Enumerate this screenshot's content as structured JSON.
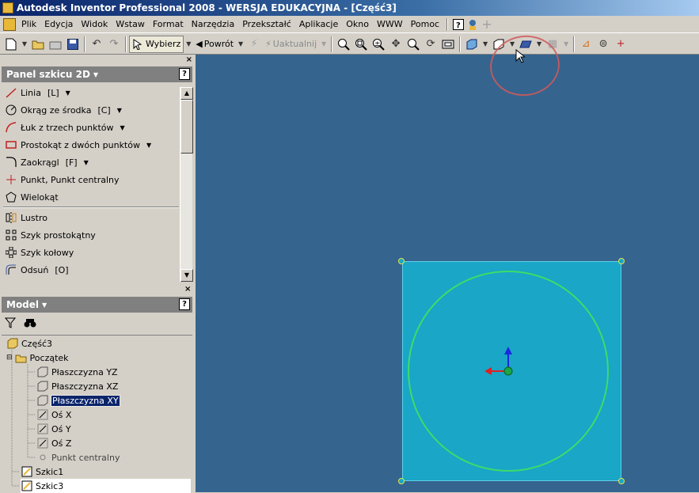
{
  "window": {
    "title": "Autodesk Inventor Professional 2008 - WERSJA EDUKACYJNA - [Część3]"
  },
  "menu": {
    "items": [
      "Plik",
      "Edycja",
      "Widok",
      "Wstaw",
      "Format",
      "Narzędzia",
      "Przekształć",
      "Aplikacje",
      "Okno",
      "WWW",
      "Pomoc"
    ]
  },
  "toolbar": {
    "select_label": "Wybierz",
    "back_label": "Powrót",
    "update_label": "Uaktualnij"
  },
  "sketch_panel": {
    "title": "Panel szkicu 2D",
    "help": "?",
    "tools": [
      {
        "label": "Linia",
        "shortcut": "[L]",
        "icon": "line-icon"
      },
      {
        "label": "Okrąg ze środka",
        "shortcut": "[C]",
        "icon": "circle-center-icon"
      },
      {
        "label": "Łuk z trzech punktów",
        "shortcut": "",
        "icon": "arc-icon"
      },
      {
        "label": "Prostokąt z dwóch punktów",
        "shortcut": "",
        "icon": "rectangle-icon"
      },
      {
        "label": "Zaokrągl",
        "shortcut": "[F]",
        "icon": "fillet-icon"
      },
      {
        "label": "Punkt, Punkt centralny",
        "shortcut": "",
        "icon": "point-icon"
      },
      {
        "label": "Wielokąt",
        "shortcut": "",
        "icon": "polygon-icon"
      },
      {
        "label": "Lustro",
        "shortcut": "",
        "icon": "mirror-icon"
      },
      {
        "label": "Szyk prostokątny",
        "shortcut": "",
        "icon": "rect-pattern-icon"
      },
      {
        "label": "Szyk kołowy",
        "shortcut": "",
        "icon": "circ-pattern-icon"
      },
      {
        "label": "Odsuń",
        "shortcut": "[O]",
        "icon": "offset-icon"
      }
    ]
  },
  "model_panel": {
    "title": "Model",
    "help": "?",
    "tree": {
      "root": "Część3",
      "origin": "Początek",
      "children": [
        "Płaszczyzna YZ",
        "Płaszczyzna XZ",
        "Płaszczyzna XY",
        "Oś X",
        "Oś Y",
        "Oś Z",
        "Punkt centralny"
      ],
      "sketches": [
        "Szkic1",
        "Szkic3"
      ],
      "selected": "Płaszczyzna XY"
    }
  },
  "colors": {
    "canvas": "#35648f",
    "sketch_fill": "#1aa6c6",
    "circle": "#3ddc6a",
    "annotation": "#d05a5a",
    "selection": "#0a246a"
  }
}
